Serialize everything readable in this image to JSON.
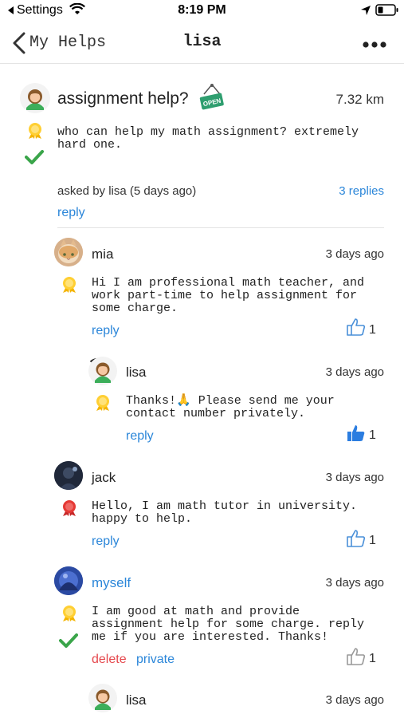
{
  "status_bar": {
    "back_app": "Settings",
    "time": "8:19 PM"
  },
  "nav": {
    "back_label": "My Helps",
    "title": "lisa",
    "more_icon": "more-horizontal-icon"
  },
  "question": {
    "title": "assignment help?",
    "badge": "OPEN",
    "distance": "7.32 km",
    "body": "who can help my math assignment? extremely\nhard one.",
    "asked_by": "asked by lisa (5 days ago)",
    "replies": "3 replies",
    "reply_label": "reply"
  },
  "replies": [
    {
      "name": "mia",
      "date": "3 days ago",
      "body": "Hi I am professional math teacher, and\nwork part-time to help assignment for\nsome charge.",
      "reply_label": "reply",
      "likes": "1",
      "liked": false
    },
    {
      "name": "lisa",
      "date": "3 days ago",
      "body": "Thanks!🙏 Please send me your\ncontact number privately.",
      "reply_label": "reply",
      "likes": "1",
      "liked": true
    },
    {
      "name": "jack",
      "date": "3 days ago",
      "body": "Hello, I am math tutor in university.\nhappy to help.",
      "reply_label": "reply",
      "likes": "1",
      "liked": false
    },
    {
      "name": "myself",
      "date": "3 days ago",
      "body": "I am good at math and provide\nassignment help for some charge. reply\nme if you are interested. Thanks!",
      "delete_label": "delete",
      "private_label": "private",
      "likes": "1",
      "liked": false
    },
    {
      "name": "lisa",
      "date": "3 days ago"
    }
  ],
  "colors": {
    "link": "#2b86d9",
    "delete": "#e5484d",
    "check": "#3aa54a",
    "badge": "#2f9e6f"
  }
}
